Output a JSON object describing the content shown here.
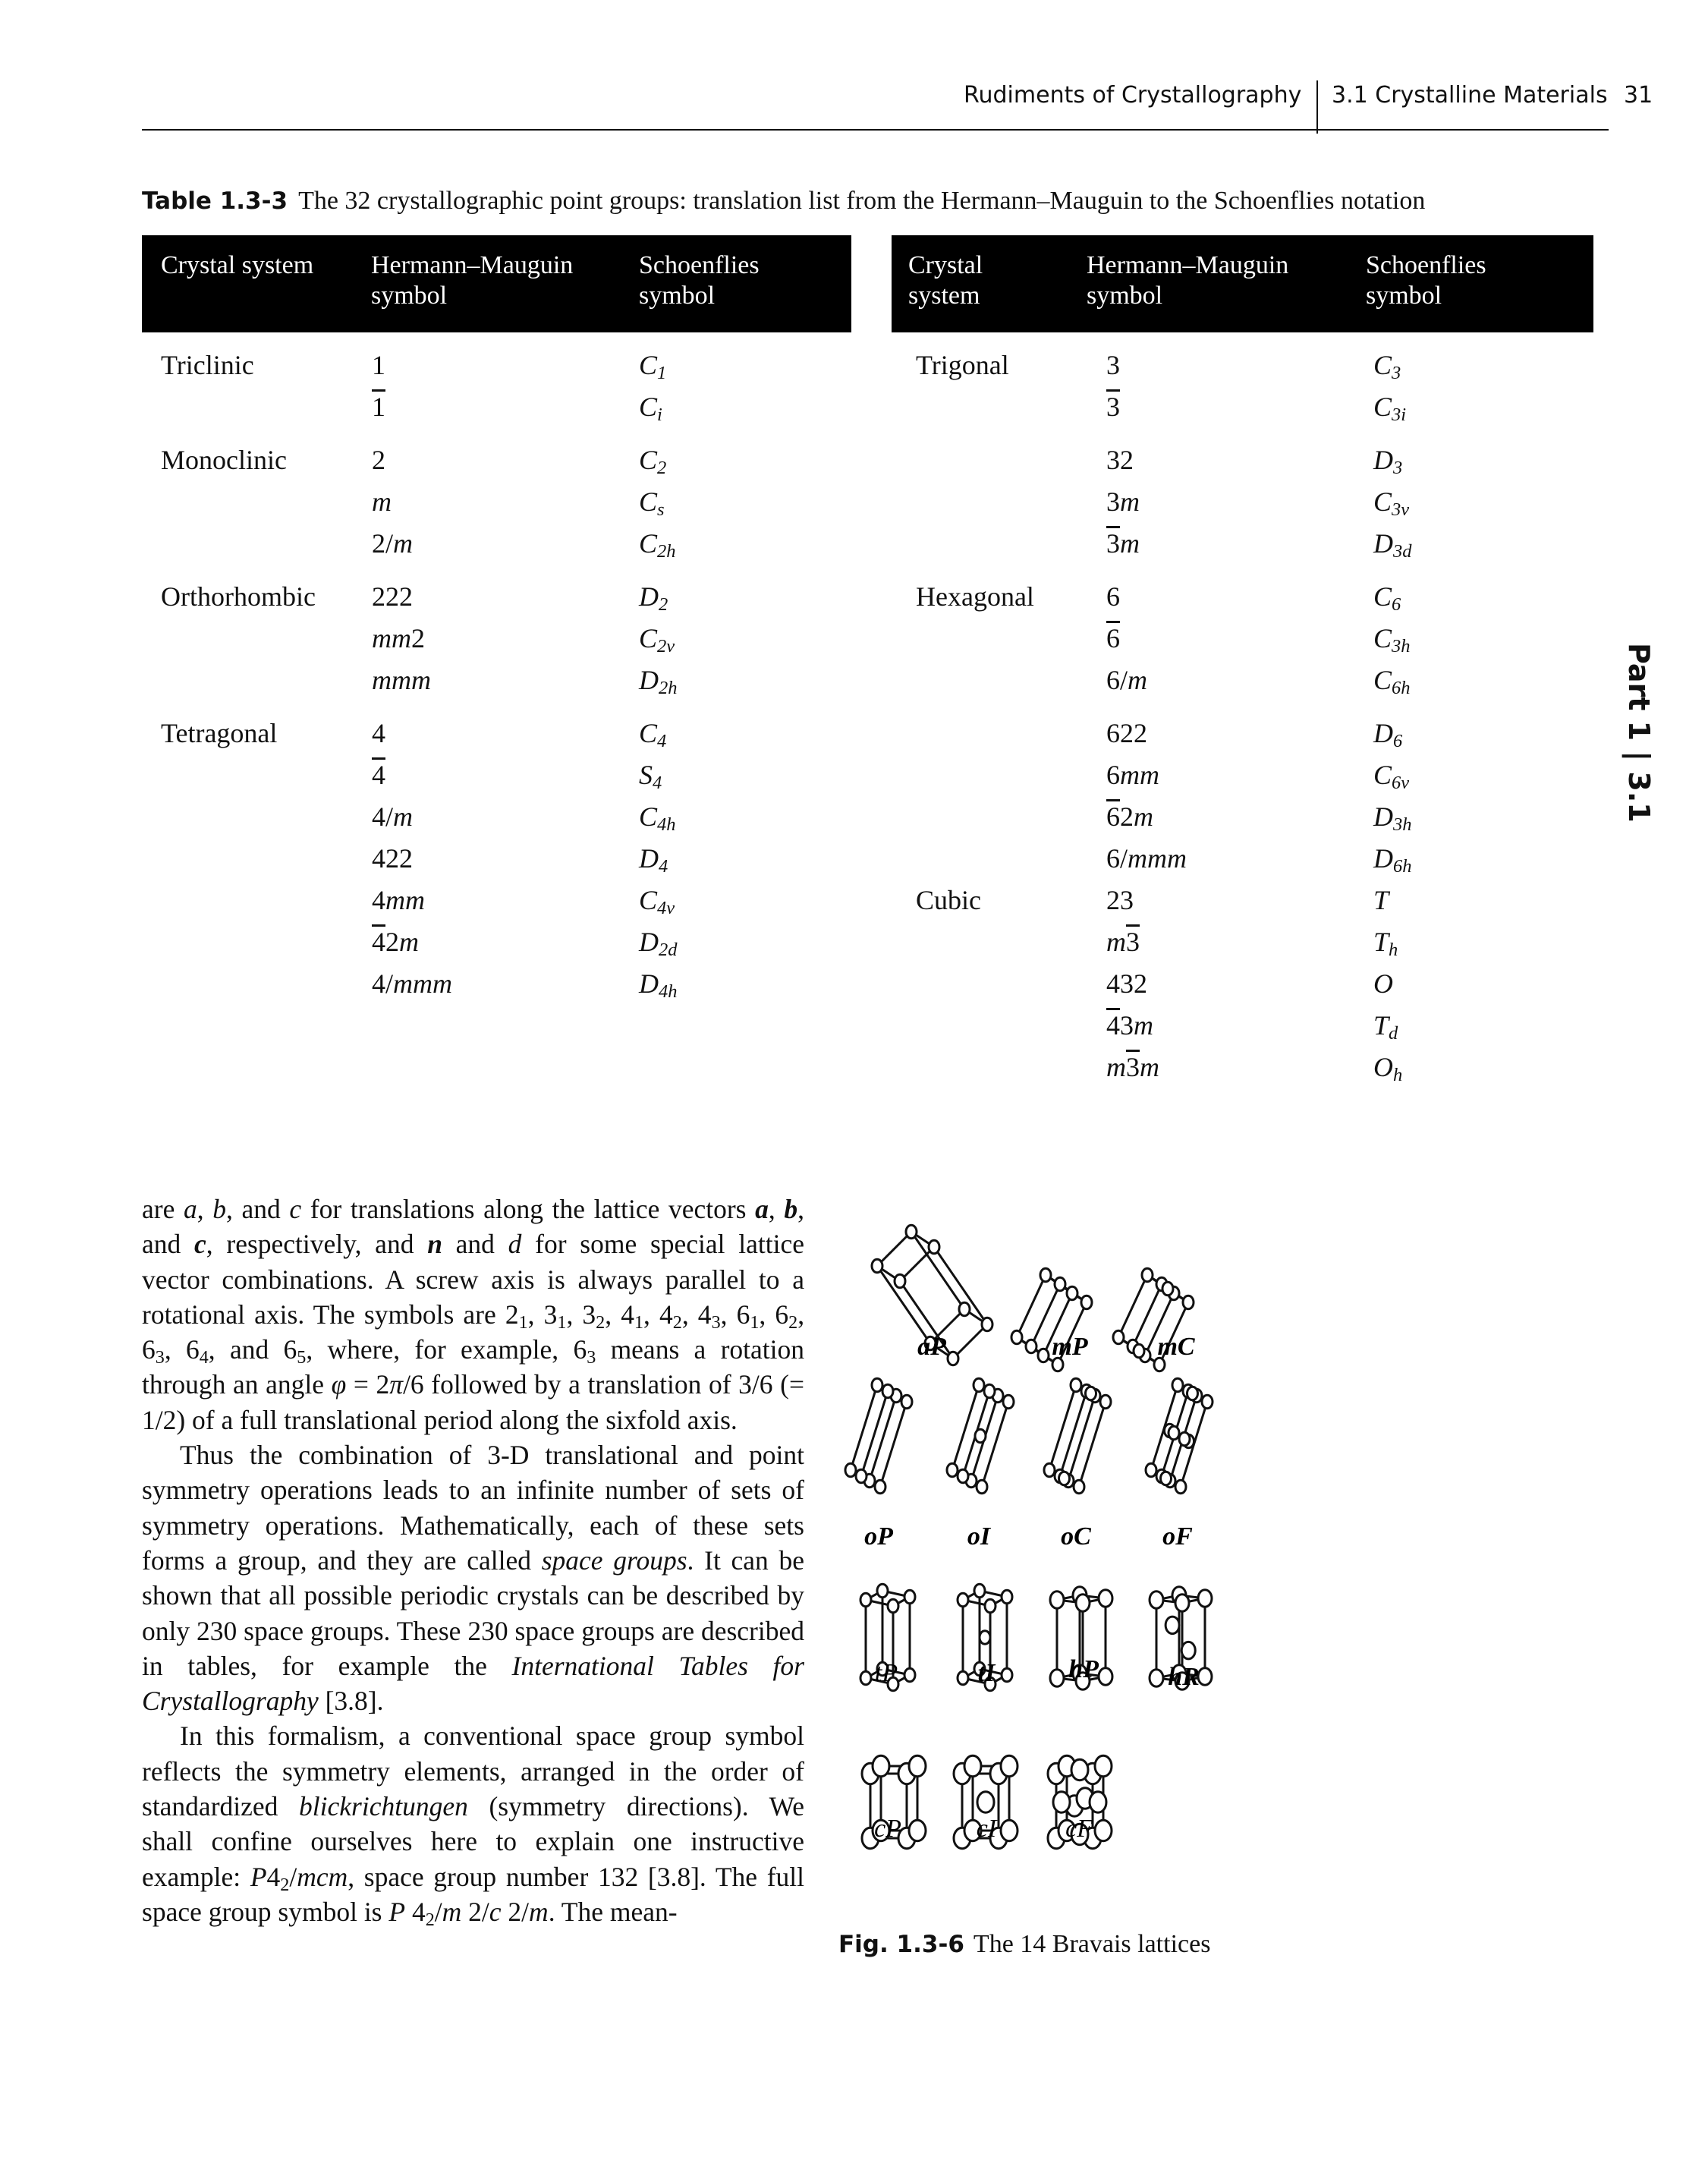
{
  "running_head": {
    "book_title": "Rudiments of Crystallography",
    "section": "3.1  Crystalline Materials",
    "page_number": "31"
  },
  "side_tab": "Part 1 | 3.1",
  "table": {
    "label": "Table 1.3-3",
    "caption": "The 32 crystallographic point groups: translation list from the Hermann–Mauguin to the Schoenflies notation",
    "headers": [
      "Crystal system",
      "Hermann–Mauguin symbol",
      "Schoenflies symbol"
    ],
    "left_rows": [
      {
        "system": "Triclinic",
        "hm": "1",
        "schoenflies": "C1"
      },
      {
        "system": "",
        "hm": "1̄",
        "schoenflies": "Ci"
      },
      {
        "system": "Monoclinic",
        "hm": "2",
        "schoenflies": "C2"
      },
      {
        "system": "",
        "hm": "m",
        "schoenflies": "Cs"
      },
      {
        "system": "",
        "hm": "2/m",
        "schoenflies": "C2h"
      },
      {
        "system": "Orthorhombic",
        "hm": "222",
        "schoenflies": "D2"
      },
      {
        "system": "",
        "hm": "mm2",
        "schoenflies": "C2v"
      },
      {
        "system": "",
        "hm": "mmm",
        "schoenflies": "D2h"
      },
      {
        "system": "Tetragonal",
        "hm": "4",
        "schoenflies": "C4"
      },
      {
        "system": "",
        "hm": "4̄",
        "schoenflies": "S4"
      },
      {
        "system": "",
        "hm": "4/m",
        "schoenflies": "C4h"
      },
      {
        "system": "",
        "hm": "422",
        "schoenflies": "D4"
      },
      {
        "system": "",
        "hm": "4mm",
        "schoenflies": "C4v"
      },
      {
        "system": "",
        "hm": "4̄2m",
        "schoenflies": "D2d"
      },
      {
        "system": "",
        "hm": "4/mmm",
        "schoenflies": "D4h"
      }
    ],
    "right_rows": [
      {
        "system": "Trigonal",
        "hm": "3",
        "schoenflies": "C3"
      },
      {
        "system": "",
        "hm": "3̄",
        "schoenflies": "C3i"
      },
      {
        "system": "",
        "hm": "32",
        "schoenflies": "D3"
      },
      {
        "system": "",
        "hm": "3m",
        "schoenflies": "C3v"
      },
      {
        "system": "",
        "hm": "3̄m",
        "schoenflies": "D3d"
      },
      {
        "system": "Hexagonal",
        "hm": "6",
        "schoenflies": "C6"
      },
      {
        "system": "",
        "hm": "6̄",
        "schoenflies": "C3h"
      },
      {
        "system": "",
        "hm": "6/m",
        "schoenflies": "C6h"
      },
      {
        "system": "",
        "hm": "622",
        "schoenflies": "D6"
      },
      {
        "system": "",
        "hm": "6mm",
        "schoenflies": "C6v"
      },
      {
        "system": "",
        "hm": "6̄2m",
        "schoenflies": "D3h"
      },
      {
        "system": "",
        "hm": "6/mmm",
        "schoenflies": "D6h"
      },
      {
        "system": "Cubic",
        "hm": "23",
        "schoenflies": "T"
      },
      {
        "system": "",
        "hm": "m3̄",
        "schoenflies": "Th"
      },
      {
        "system": "",
        "hm": "432",
        "schoenflies": "O"
      },
      {
        "system": "",
        "hm": "4̄3m",
        "schoenflies": "Td"
      },
      {
        "system": "",
        "hm": "m3̄m",
        "schoenflies": "Oh"
      }
    ]
  },
  "body": {
    "p1": "are a, b, and c for translations along the lattice vectors a, b, and c, respectively, and n and d for some special lattice vector combinations. A screw axis is always parallel to a rotational axis. The symbols are 2₁, 3₁, 3₂, 4₁, 4₂, 4₃, 6₁, 6₂, 6₃, 6₄, and 6₅, where, for example, 6₃ means a rotation through an angle φ = 2π/6 followed by a translation of 3/6 (= 1/2) of a full translational period along the sixfold axis.",
    "p2": "Thus the combination of 3-D translational and point symmetry operations leads to an infinite number of sets of symmetry operations. Mathematically, each of these sets forms a group, and they are called space groups. It can be shown that all possible periodic crystals can be described by only 230 space groups. These 230 space groups are described in tables, for example the International Tables for Crystallography [3.8].",
    "p3": "In this formalism, a conventional space group symbol reflects the symmetry elements, arranged in the order of standardized blickrichtungen (symmetry directions). We shall confine ourselves here to explain one instructive example: P4₂/mcm, space group number 132 [3.8]. The full space group symbol is P 4₂/m 2/c 2/m. The mean-"
  },
  "figure": {
    "label": "Fig. 1.3-6",
    "caption": "The 14 Bravais lattices",
    "lattices": [
      "aP",
      "mP",
      "mC",
      "oP",
      "oI",
      "oC",
      "oF",
      "tP",
      "tI",
      "hP",
      "hR",
      "cP",
      "cI",
      "cF"
    ]
  }
}
